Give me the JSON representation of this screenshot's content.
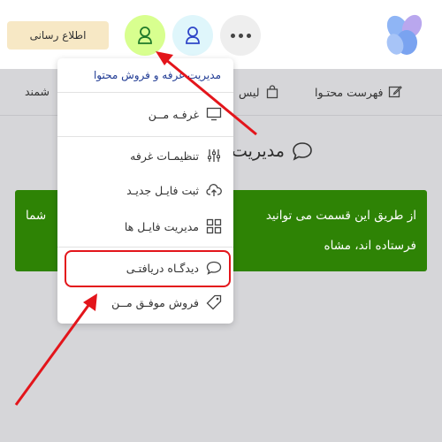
{
  "header": {
    "info_button": "اطلاع رسانی"
  },
  "navbar": {
    "content_list": "فهرست محتـوا",
    "list_partial": "لیس",
    "smart_partial": "شمند"
  },
  "page": {
    "title_partial": "مدیریت"
  },
  "banner": {
    "line1": "از طریق این قسمت می توانید",
    "line1_tail": "شما",
    "line2": "فرستاده اند، مشاه"
  },
  "dropdown": {
    "header": "مدیریت غرفه و فروش محتوا",
    "items": [
      {
        "label": "غرفـه مــن",
        "icon": "monitor-icon"
      },
      {
        "label": "تنظیمـات غرفه",
        "icon": "sliders-icon"
      },
      {
        "label": "ثبت فایـل جدیـد",
        "icon": "cloud-upload-icon"
      },
      {
        "label": "مدیریت فایـل ها",
        "icon": "grid-icon"
      },
      {
        "label": "دیدگـاه دریافتـی",
        "icon": "comment-icon"
      },
      {
        "label": "فروش موفـق مــن",
        "icon": "tag-icon"
      }
    ]
  },
  "colors": {
    "banner": "#2e8305",
    "highlight": "#e3151b",
    "active_button": "#d8ff8f"
  }
}
